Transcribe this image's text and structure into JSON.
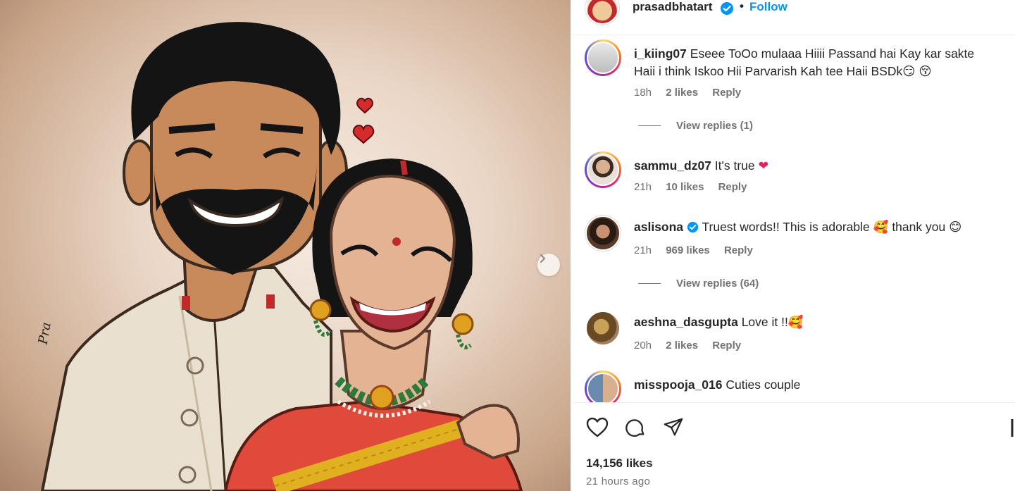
{
  "post": {
    "author": "prasadbhatart",
    "follow_label": "Follow",
    "dot": "•",
    "likes": "14,156 likes",
    "time_ago": "21 hours ago",
    "artist_signature": "Pra"
  },
  "comments": [
    {
      "username": "i_kiing07",
      "text": "Eseee ToOo mulaaa Hiiii Passand hai Kay kar sakte Haii i think Iskoo Hii Parvarish Kah tee Haii BSDk",
      "emoji": "😏 😚",
      "time": "18h",
      "likes": "2 likes",
      "reply": "Reply",
      "view_replies": "View replies (1)"
    },
    {
      "username": "sammu_dz07",
      "text": "It's true",
      "emoji": "❤",
      "time": "21h",
      "likes": "10 likes",
      "reply": "Reply"
    },
    {
      "username": "aslisona",
      "text": "Truest words!! This is adorable",
      "text2": "thank you",
      "emoji": "🥰",
      "emoji2": "😊",
      "time": "21h",
      "likes": "969 likes",
      "reply": "Reply",
      "view_replies": "View replies (64)"
    },
    {
      "username": "aeshna_dasgupta",
      "text": "Love it !!",
      "emoji": "🥰",
      "time": "20h",
      "likes": "2 likes",
      "reply": "Reply"
    },
    {
      "username": "misspooja_016",
      "text": "Cuties couple"
    }
  ],
  "icons": {
    "like": "heart-icon",
    "comment": "comment-icon",
    "share": "share-icon",
    "save": "bookmark-icon",
    "next": "chevron-right-icon",
    "verified": "verified-badge-icon"
  },
  "colors": {
    "link": "#0095f6",
    "muted": "#737373",
    "verified": "#0095f6",
    "heart": "#e0245e"
  }
}
